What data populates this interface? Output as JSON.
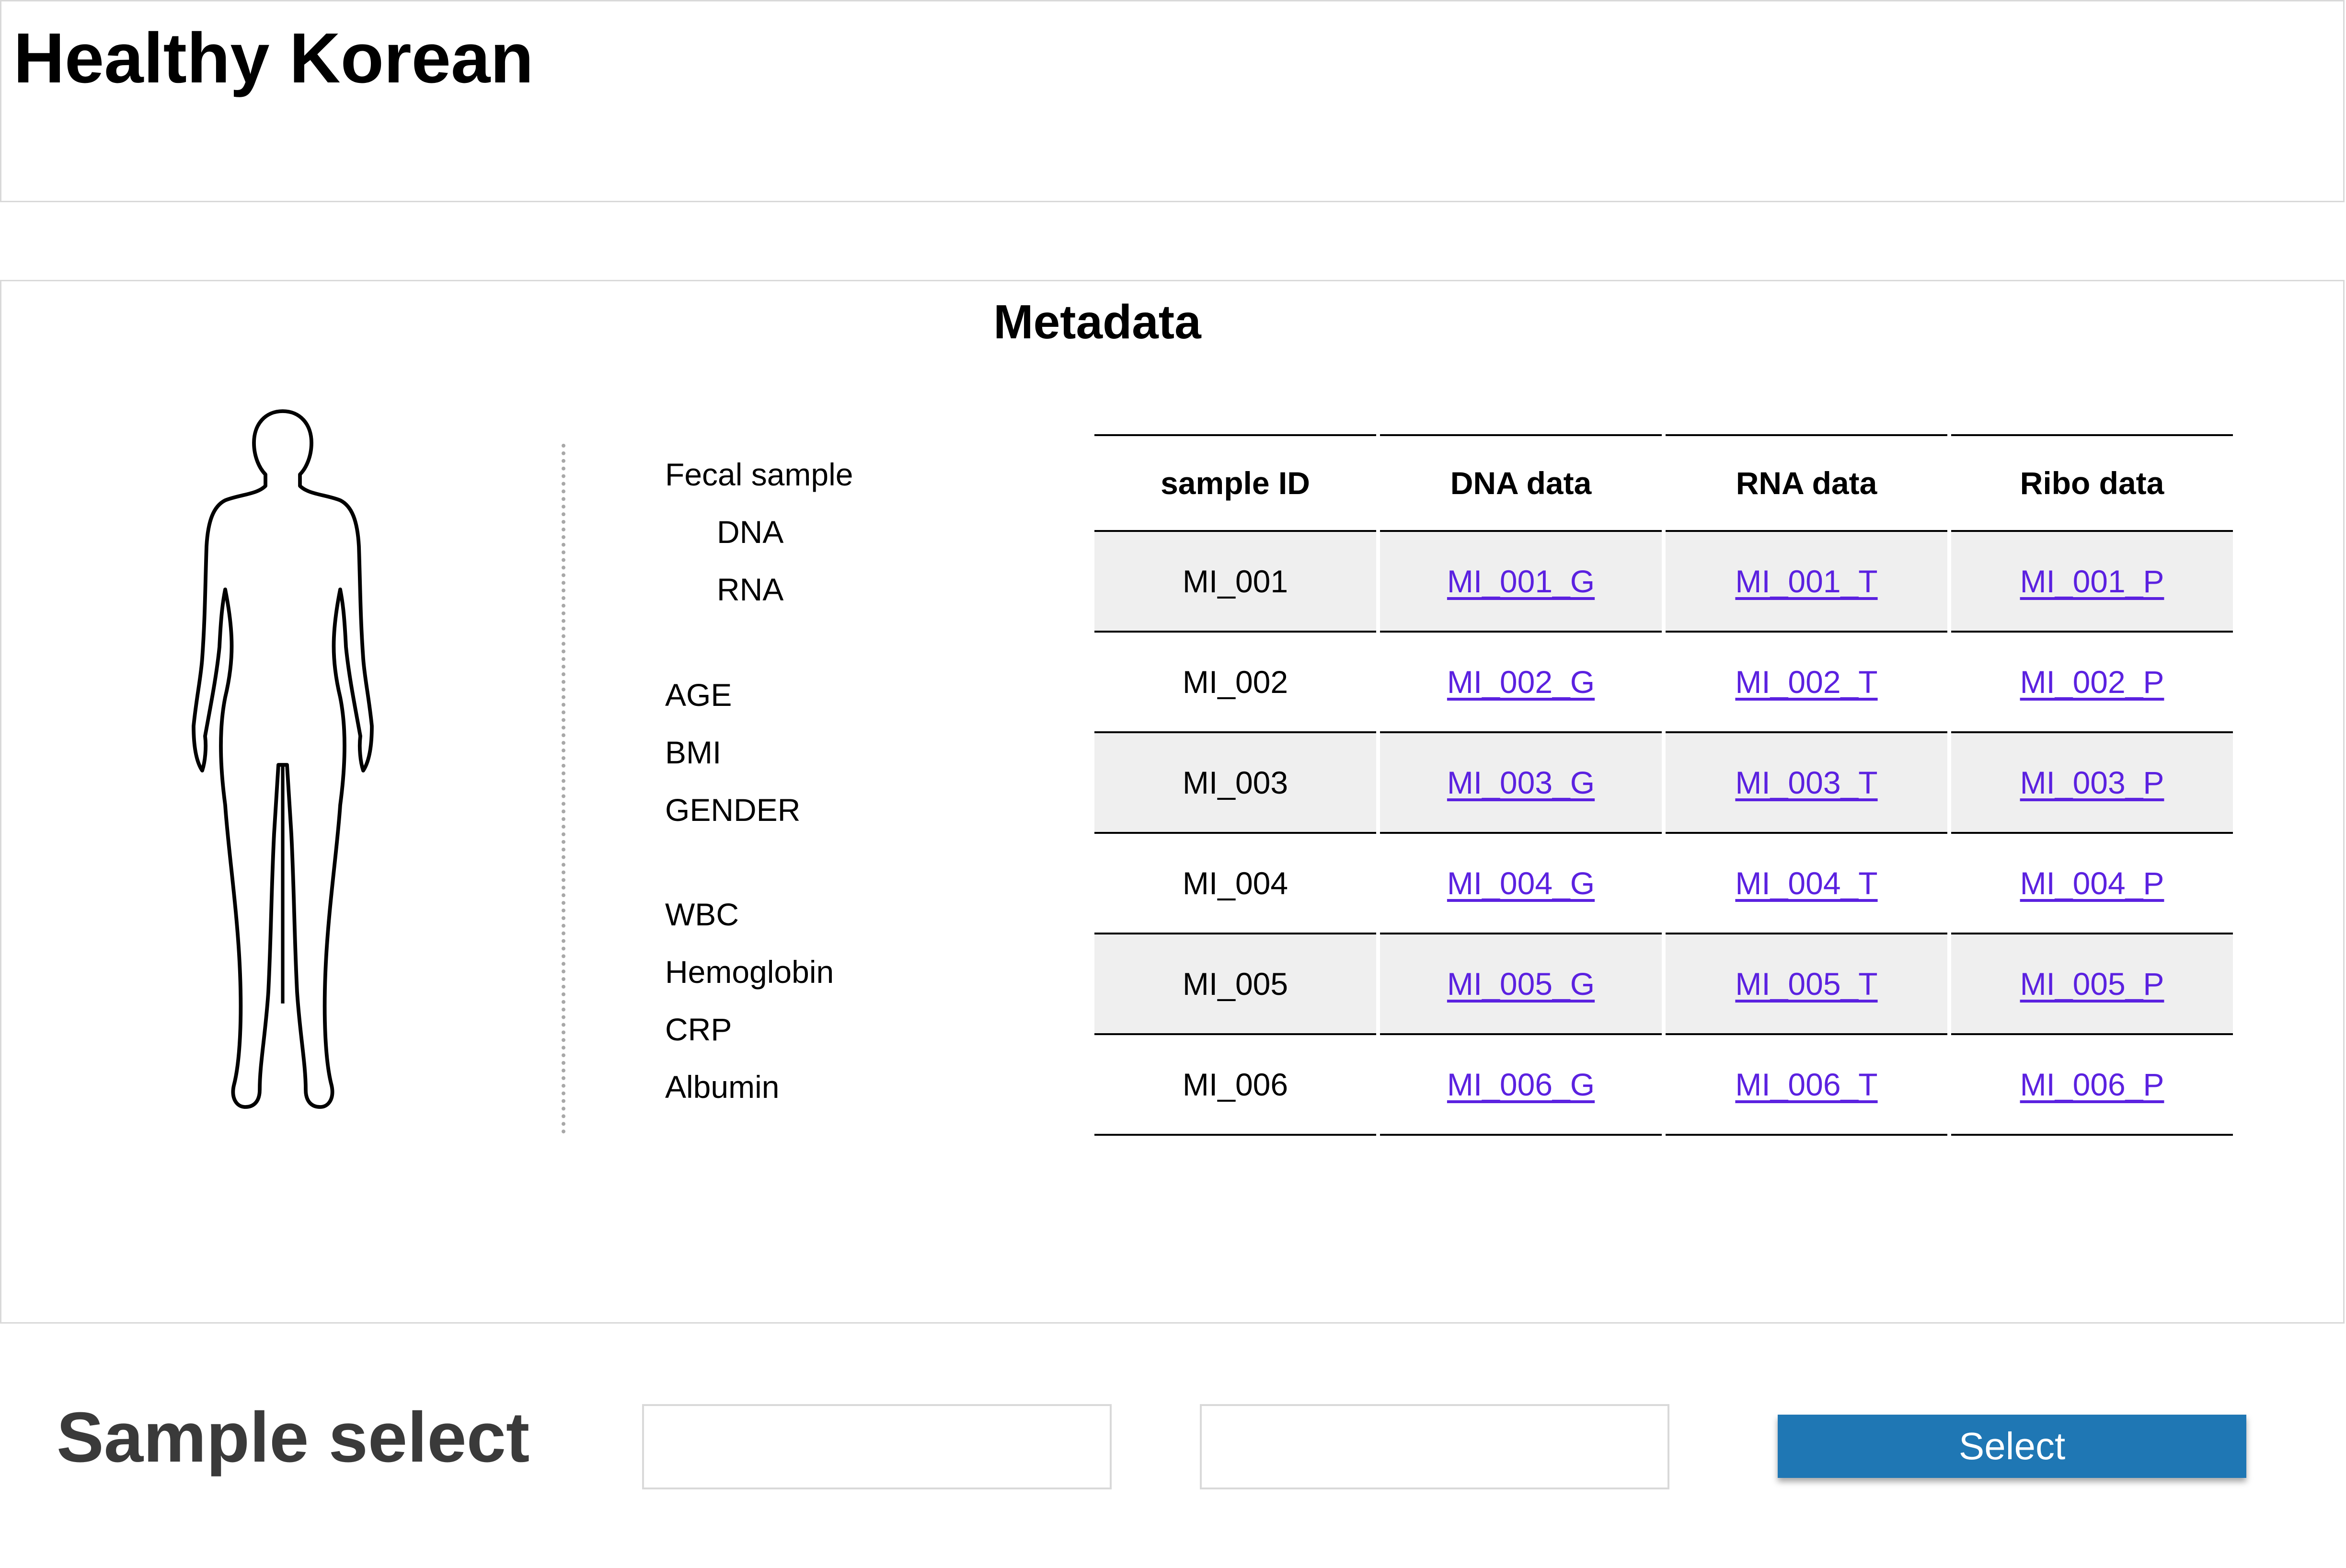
{
  "header": {
    "title": "Healthy Korean"
  },
  "metadata": {
    "title": "Metadata",
    "attributes": {
      "fecal_sample": "Fecal sample",
      "dna": "DNA",
      "rna": "RNA",
      "age": "AGE",
      "bmi": "BMI",
      "gender": "GENDER",
      "wbc": "WBC",
      "hemoglobin": "Hemoglobin",
      "crp": "CRP",
      "albumin": "Albumin"
    },
    "table": {
      "headers": [
        "sample ID",
        "DNA data",
        "RNA data",
        "Ribo data"
      ],
      "rows": [
        [
          "MI_001",
          "MI_001_G",
          "MI_001_T",
          "MI_001_P"
        ],
        [
          "MI_002",
          "MI_002_G",
          "MI_002_T",
          "MI_002_P"
        ],
        [
          "MI_003",
          "MI_003_G",
          "MI_003_T",
          "MI_003_P"
        ],
        [
          "MI_004",
          "MI_004_G",
          "MI_004_T",
          "MI_004_P"
        ],
        [
          "MI_005",
          "MI_005_G",
          "MI_005_T",
          "MI_005_P"
        ],
        [
          "MI_006",
          "MI_006_G",
          "MI_006_T",
          "MI_006_P"
        ]
      ]
    },
    "figure_icon": "human-body-outline-icon"
  },
  "sample_select": {
    "title": "Sample select",
    "input1": {
      "value": "",
      "placeholder": ""
    },
    "input2": {
      "value": "",
      "placeholder": ""
    },
    "button_label": "Select"
  },
  "colors": {
    "link": "#5b21e0",
    "button": "#1f77b4",
    "row_shade": "#efefef",
    "panel_border": "#d9d9d9"
  }
}
